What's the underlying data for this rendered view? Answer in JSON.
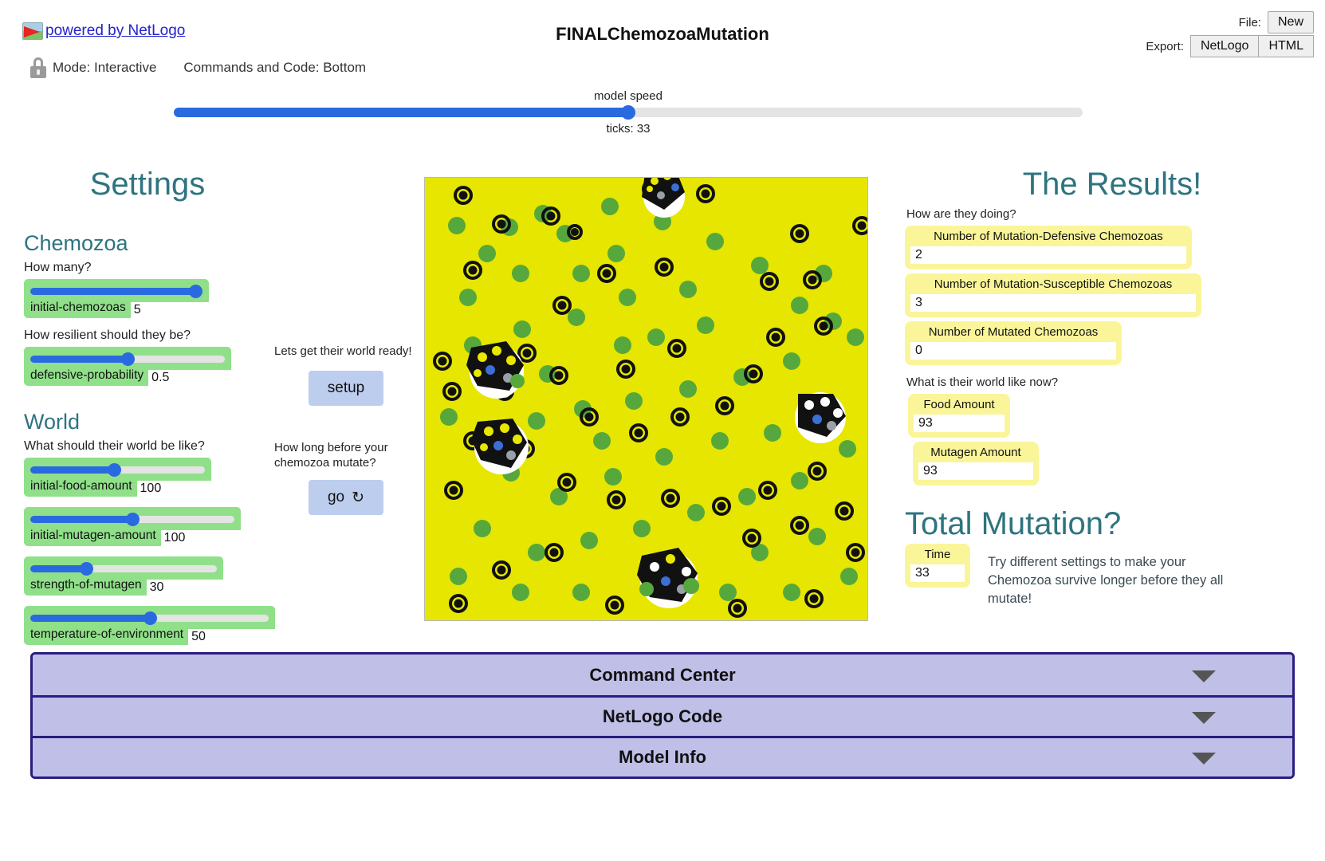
{
  "header": {
    "powered_by": "powered by NetLogo",
    "mode": "Mode: Interactive",
    "commands_and_code": "Commands and Code: Bottom",
    "title": "FINALChemozoaMutation",
    "file_label": "File:",
    "file_new": "New",
    "export_label": "Export:",
    "export_netlogo": "NetLogo",
    "export_html": "HTML"
  },
  "speed": {
    "label": "model speed",
    "ticks": "ticks: 33",
    "percent": 50
  },
  "settings": {
    "title": "Settings",
    "chemozoa": {
      "heading": "Chemozoa",
      "q_how_many": "How many?",
      "q_resilient": "How resilient should they be?",
      "sliders": [
        {
          "name": "initial-chemozoas",
          "value": "5",
          "percent": 96
        },
        {
          "name": "defensive-probability",
          "value": "0.5",
          "percent": 50
        }
      ]
    },
    "world": {
      "heading": "World",
      "q_world": "What should their world be like?",
      "sliders": [
        {
          "name": "initial-food-amount",
          "value": "100",
          "percent": 48
        },
        {
          "name": "initial-mutagen-amount",
          "value": "100",
          "percent": 50
        },
        {
          "name": "strength-of-mutagen",
          "value": "30",
          "percent": 30
        },
        {
          "name": "temperature-of-environment",
          "value": "50",
          "percent": 50
        }
      ]
    }
  },
  "controls": {
    "setup_note": "Lets get their world ready!",
    "setup_label": "setup",
    "go_note": "How long before your chemozoa mutate?",
    "go_label": "go",
    "forever_glyph": "↻"
  },
  "results": {
    "title": "The Results!",
    "q_doing": "How are they doing?",
    "q_world": "What is their world like now?",
    "monitors": [
      {
        "label": "Number of Mutation-Defensive Chemozoas",
        "value": "2"
      },
      {
        "label": "Number of Mutation-Susceptible Chemozoas",
        "value": "3"
      },
      {
        "label": "Number of Mutated Chemozoas",
        "value": "0"
      }
    ],
    "world_monitors": [
      {
        "label": "Food Amount",
        "value": "93"
      },
      {
        "label": "Mutagen Amount",
        "value": "93"
      }
    ]
  },
  "total_mutation": {
    "title": "Total Mutation?",
    "time_label": "Time",
    "time_value": "33",
    "advice": "Try different settings to make your Chemozoa survive longer before they all mutate!"
  },
  "accordions": [
    {
      "label": "Command Center"
    },
    {
      "label": "NetLogo Code"
    },
    {
      "label": "Model Info"
    }
  ],
  "colors": {
    "teal_heading": "#2e7480",
    "slider_green": "#90e08a",
    "slider_blue": "#2a6ae0",
    "monitor_yellow": "#fbf59a",
    "accordion_purple": "#bfbfe8",
    "accordion_border": "#2b1d80",
    "button_blue": "#bdcdee",
    "world_background": "#e6e600",
    "food_green": "#57a83c",
    "link_blue": "#2222cc"
  },
  "world_view": {
    "food_label": "food-patch",
    "mutagen_label": "mutagen-particle",
    "chemozoa_label": "chemozoa-organism"
  }
}
